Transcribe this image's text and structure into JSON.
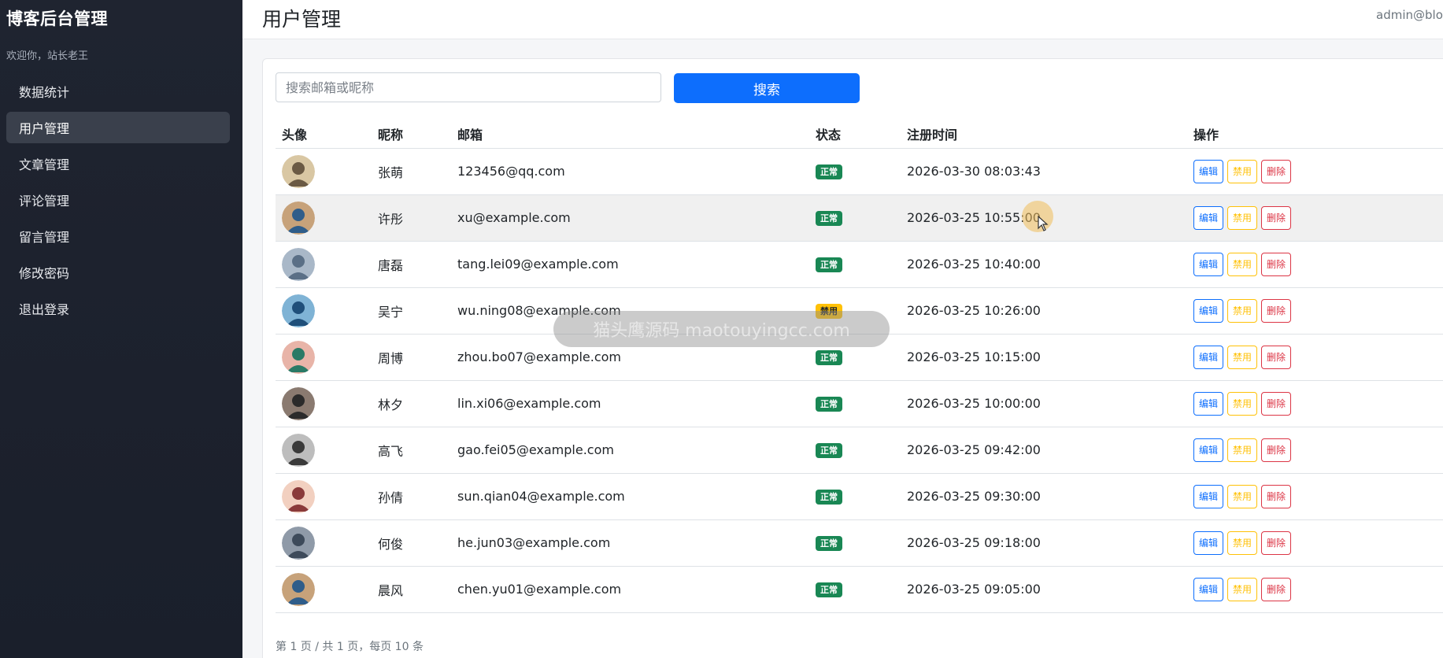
{
  "sidebar": {
    "brand": "博客后台管理",
    "welcome": "欢迎你，站长老王",
    "items": [
      {
        "label": "数据统计",
        "active": false
      },
      {
        "label": "用户管理",
        "active": true
      },
      {
        "label": "文章管理",
        "active": false
      },
      {
        "label": "评论管理",
        "active": false
      },
      {
        "label": "留言管理",
        "active": false
      },
      {
        "label": "修改密码",
        "active": false
      },
      {
        "label": "退出登录",
        "active": false
      }
    ]
  },
  "header": {
    "title": "用户管理",
    "user": "admin@blog"
  },
  "search": {
    "placeholder": "搜索邮箱或昵称",
    "button": "搜索"
  },
  "table": {
    "columns": [
      "头像",
      "昵称",
      "邮箱",
      "状态",
      "注册时间",
      "操作"
    ],
    "actions": {
      "edit": "编辑",
      "ban": "禁用",
      "delete": "删除"
    },
    "rows": [
      {
        "nickname": "张萌",
        "email": "123456@qq.com",
        "status": "正常",
        "registered": "2026-03-30 08:03:43"
      },
      {
        "nickname": "许彤",
        "email": "xu@example.com",
        "status": "正常",
        "registered": "2026-03-25 10:55:00"
      },
      {
        "nickname": "唐磊",
        "email": "tang.lei09@example.com",
        "status": "正常",
        "registered": "2026-03-25 10:40:00"
      },
      {
        "nickname": "吴宁",
        "email": "wu.ning08@example.com",
        "status": "禁用",
        "registered": "2026-03-25 10:26:00"
      },
      {
        "nickname": "周博",
        "email": "zhou.bo07@example.com",
        "status": "正常",
        "registered": "2026-03-25 10:15:00"
      },
      {
        "nickname": "林夕",
        "email": "lin.xi06@example.com",
        "status": "正常",
        "registered": "2026-03-25 10:00:00"
      },
      {
        "nickname": "高飞",
        "email": "gao.fei05@example.com",
        "status": "正常",
        "registered": "2026-03-25 09:42:00"
      },
      {
        "nickname": "孙倩",
        "email": "sun.qian04@example.com",
        "status": "正常",
        "registered": "2026-03-25 09:30:00"
      },
      {
        "nickname": "何俊",
        "email": "he.jun03@example.com",
        "status": "正常",
        "registered": "2026-03-25 09:18:00"
      },
      {
        "nickname": "晨风",
        "email": "chen.yu01@example.com",
        "status": "正常",
        "registered": "2026-03-25 09:05:00"
      }
    ]
  },
  "pagination": {
    "text": "第 1 页 / 共 1 页，每页 10 条"
  },
  "watermark": "猫头鹰源码 maotouyingcc.com",
  "colors": {
    "primary": "#0d6efd",
    "success": "#198754",
    "warning": "#ffc107",
    "danger": "#dc3545",
    "sidebar": "#1f2430"
  }
}
